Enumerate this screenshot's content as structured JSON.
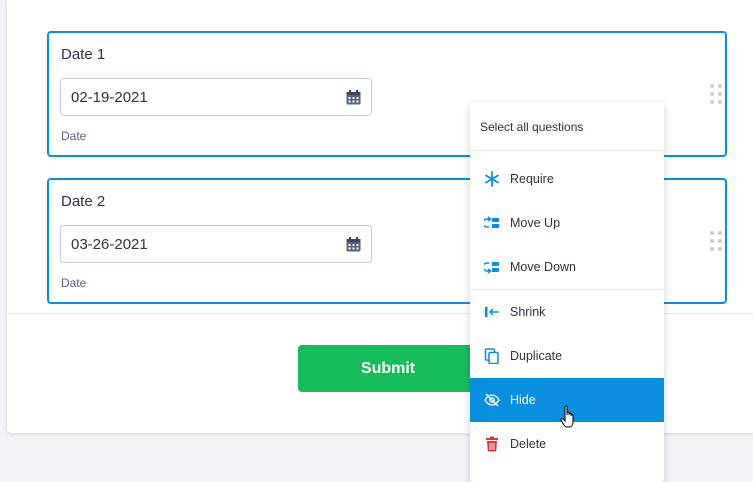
{
  "questions": [
    {
      "label": "Date 1",
      "value": "02-19-2021",
      "sublabel": "Date"
    },
    {
      "label": "Date 2",
      "value": "03-26-2021",
      "sublabel": "Date"
    }
  ],
  "submit": {
    "label": "Submit",
    "color": "#18bd5b"
  },
  "context_menu": {
    "header": "Select all questions",
    "items": [
      {
        "label": "Require",
        "icon": "asterisk-icon"
      },
      {
        "label": "Move Up",
        "icon": "move-up-icon"
      },
      {
        "label": "Move Down",
        "icon": "move-down-icon"
      },
      {
        "label": "Shrink",
        "icon": "shrink-icon"
      },
      {
        "label": "Duplicate",
        "icon": "duplicate-icon"
      },
      {
        "label": "Hide",
        "icon": "hide-icon",
        "highlighted": true
      },
      {
        "label": "Delete",
        "icon": "trash-icon"
      }
    ]
  },
  "colors": {
    "accent": "#0a8ee0",
    "delete": "#d93838"
  }
}
